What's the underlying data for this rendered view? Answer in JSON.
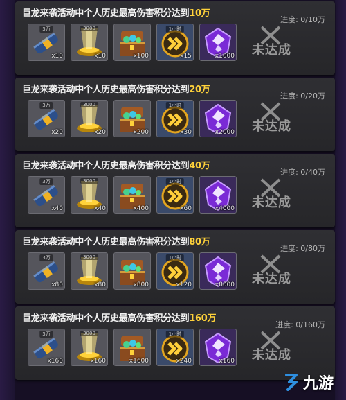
{
  "colors": {
    "card": "#2b2b2e",
    "title": "#f0f0f0",
    "target": "#ffd23a",
    "status": "#9a9a9a",
    "watermark_accent": "#2e8fe0"
  },
  "quests": [
    {
      "title_prefix": "巨龙来袭活动中个人历史最高伤害积分达到",
      "target": "10万",
      "progress": "进度: 0/10万",
      "status": "未达成",
      "rewards": [
        {
          "icon": "blue-scroll-icon",
          "tag": "3万",
          "qty": "x10"
        },
        {
          "icon": "gold-pillar-icon",
          "tag": "3000",
          "qty": "x10"
        },
        {
          "icon": "gem-chest-icon",
          "tag": "",
          "qty": "x100"
        },
        {
          "icon": "speedup-chevron-icon",
          "tag": "1小时",
          "qty": "x15"
        },
        {
          "icon": "purple-crystal-icon",
          "tag": "",
          "qty": "x1000"
        }
      ]
    },
    {
      "title_prefix": "巨龙来袭活动中个人历史最高伤害积分达到",
      "target": "20万",
      "progress": "进度: 0/20万",
      "status": "未达成",
      "rewards": [
        {
          "icon": "blue-scroll-icon",
          "tag": "3万",
          "qty": "x20"
        },
        {
          "icon": "gold-pillar-icon",
          "tag": "3000",
          "qty": "x20"
        },
        {
          "icon": "gem-chest-icon",
          "tag": "",
          "qty": "x200"
        },
        {
          "icon": "speedup-chevron-icon",
          "tag": "1小时",
          "qty": "x30"
        },
        {
          "icon": "purple-crystal-icon",
          "tag": "",
          "qty": "x2000"
        }
      ]
    },
    {
      "title_prefix": "巨龙来袭活动中个人历史最高伤害积分达到",
      "target": "40万",
      "progress": "进度: 0/40万",
      "status": "未达成",
      "rewards": [
        {
          "icon": "blue-scroll-icon",
          "tag": "3万",
          "qty": "x40"
        },
        {
          "icon": "gold-pillar-icon",
          "tag": "3000",
          "qty": "x40"
        },
        {
          "icon": "gem-chest-icon",
          "tag": "",
          "qty": "x400"
        },
        {
          "icon": "speedup-chevron-icon",
          "tag": "1小时",
          "qty": "x60"
        },
        {
          "icon": "purple-crystal-icon",
          "tag": "",
          "qty": "x4000"
        }
      ]
    },
    {
      "title_prefix": "巨龙来袭活动中个人历史最高伤害积分达到",
      "target": "80万",
      "progress": "进度: 0/80万",
      "status": "未达成",
      "rewards": [
        {
          "icon": "blue-scroll-icon",
          "tag": "3万",
          "qty": "x80"
        },
        {
          "icon": "gold-pillar-icon",
          "tag": "3000",
          "qty": "x80"
        },
        {
          "icon": "gem-chest-icon",
          "tag": "",
          "qty": "x800"
        },
        {
          "icon": "speedup-chevron-icon",
          "tag": "1小时",
          "qty": "x120"
        },
        {
          "icon": "purple-crystal-icon",
          "tag": "",
          "qty": "x8000"
        }
      ]
    },
    {
      "title_prefix": "巨龙来袭活动中个人历史最高伤害积分达到",
      "target": "160万",
      "progress": "进度: 0/160万",
      "status": "未达成",
      "rewards": [
        {
          "icon": "blue-scroll-icon",
          "tag": "3万",
          "qty": "x160"
        },
        {
          "icon": "gold-pillar-icon",
          "tag": "3000",
          "qty": "x160"
        },
        {
          "icon": "gem-chest-icon",
          "tag": "",
          "qty": "x1600"
        },
        {
          "icon": "speedup-chevron-icon",
          "tag": "1小时",
          "qty": "x240"
        },
        {
          "icon": "purple-crystal-icon",
          "tag": "",
          "qty": "x160"
        }
      ]
    }
  ],
  "watermark": {
    "icon": "jiuyou-logo-icon",
    "text": "九游"
  }
}
